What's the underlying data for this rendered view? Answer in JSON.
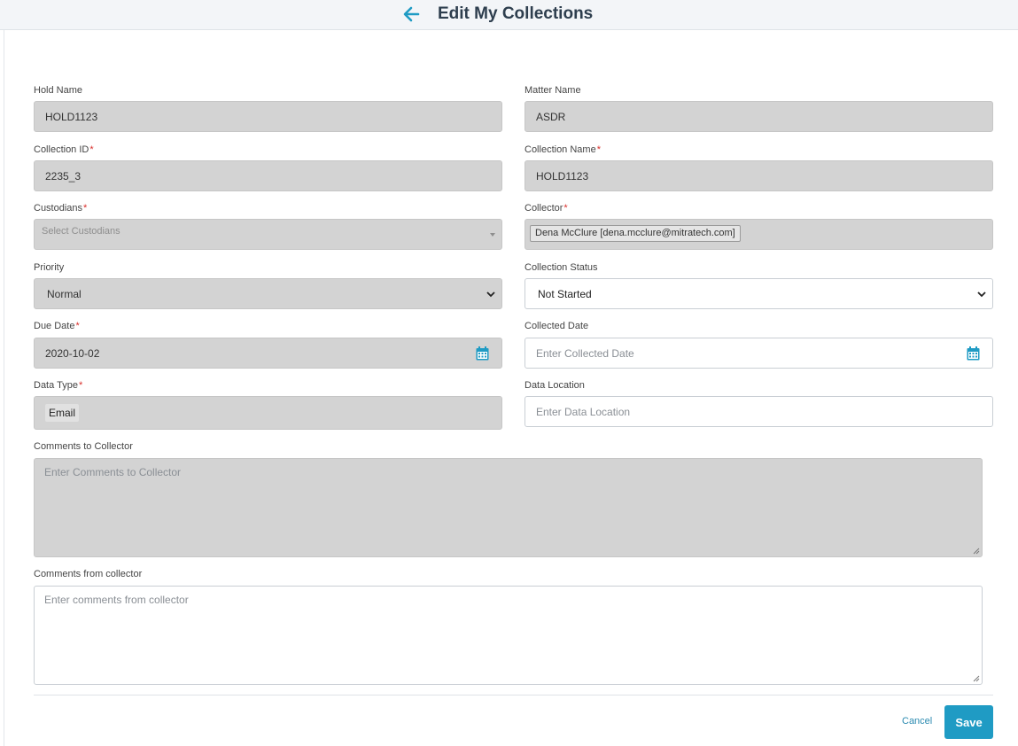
{
  "header": {
    "title": "Edit My Collections",
    "back_icon": "arrow-left-icon",
    "accent_color": "#1f9bc4"
  },
  "form": {
    "hold_name": {
      "label": "Hold Name",
      "value": "HOLD1123"
    },
    "matter_name": {
      "label": "Matter Name",
      "value": "ASDR"
    },
    "collection_id": {
      "label": "Collection ID",
      "required_mark": "*",
      "value": "2235_3"
    },
    "collection_name": {
      "label": "Collection Name",
      "required_mark": "*",
      "value": "HOLD1123"
    },
    "custodians": {
      "label": "Custodians",
      "required_mark": "*",
      "placeholder": "Select Custodians"
    },
    "collector": {
      "label": "Collector",
      "required_mark": "*",
      "value": "Dena McClure [dena.mcclure@mitratech.com]"
    },
    "priority": {
      "label": "Priority",
      "value": "Normal"
    },
    "collection_status": {
      "label": "Collection Status",
      "value": "Not Started"
    },
    "due_date": {
      "label": "Due Date",
      "required_mark": "*",
      "value": "2020-10-02"
    },
    "collected_date": {
      "label": "Collected Date",
      "placeholder": "Enter Collected Date"
    },
    "data_type": {
      "label": "Data Type",
      "required_mark": "*",
      "value": "Email"
    },
    "data_location": {
      "label": "Data Location",
      "placeholder": "Enter Data Location"
    },
    "comments_to_collector": {
      "label": "Comments to Collector",
      "placeholder": "Enter Comments to Collector"
    },
    "comments_from_collector": {
      "label": "Comments from collector",
      "placeholder": "Enter comments from collector"
    }
  },
  "footer": {
    "cancel_label": "Cancel",
    "save_label": "Save"
  }
}
